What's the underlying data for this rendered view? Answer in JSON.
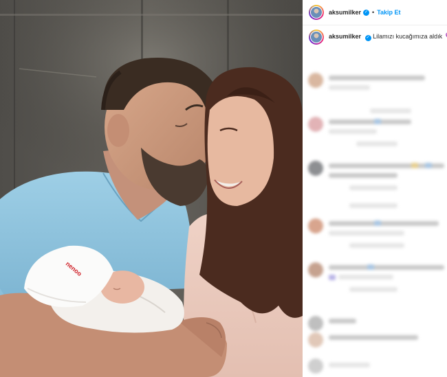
{
  "header": {
    "username": "aksumilker",
    "separator": "•",
    "follow_label": "Takip Et"
  },
  "caption": {
    "username": "aksumilker",
    "text": "Lilamızı kucağımıza aldık",
    "emoji": "💜"
  },
  "photo": {
    "hat_text": "nenoo"
  },
  "colors": {
    "accent": "#0095f6",
    "verified": "#0095f6",
    "heart": "#6b4fcf"
  }
}
